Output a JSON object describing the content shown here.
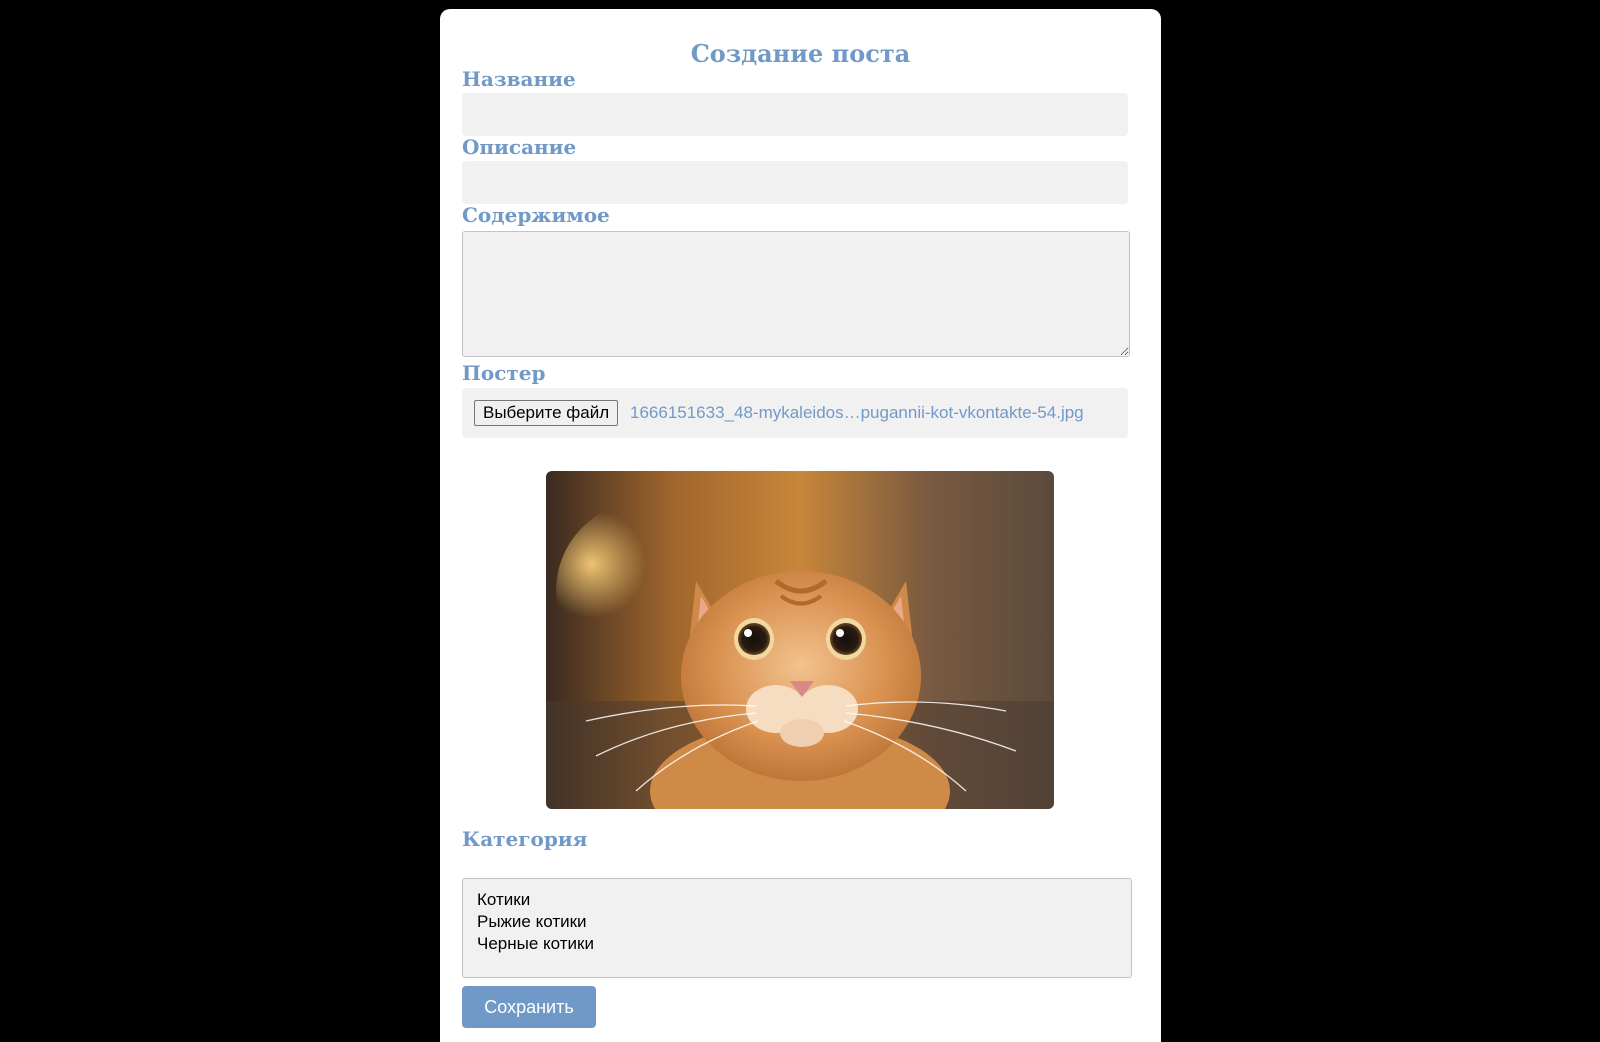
{
  "form": {
    "title": "Создание поста",
    "name_label": "Название",
    "name_value": "",
    "description_label": "Описание",
    "description_value": "",
    "content_label": "Содержимое",
    "content_value": "",
    "poster_label": "Постер",
    "file_button_label": "Выберите файл",
    "file_name": "1666151633_48-mykaleidos…pugannii-kot-vkontakte-54.jpg",
    "category_label": "Категория",
    "category_options": [
      "Котики",
      "Рыжие котики",
      "Черные котики"
    ],
    "save_label": "Сохранить"
  },
  "colors": {
    "accent": "#7199c8",
    "field_bg": "#f1f1f1",
    "page_bg": "#000000",
    "card_bg": "#ffffff"
  }
}
